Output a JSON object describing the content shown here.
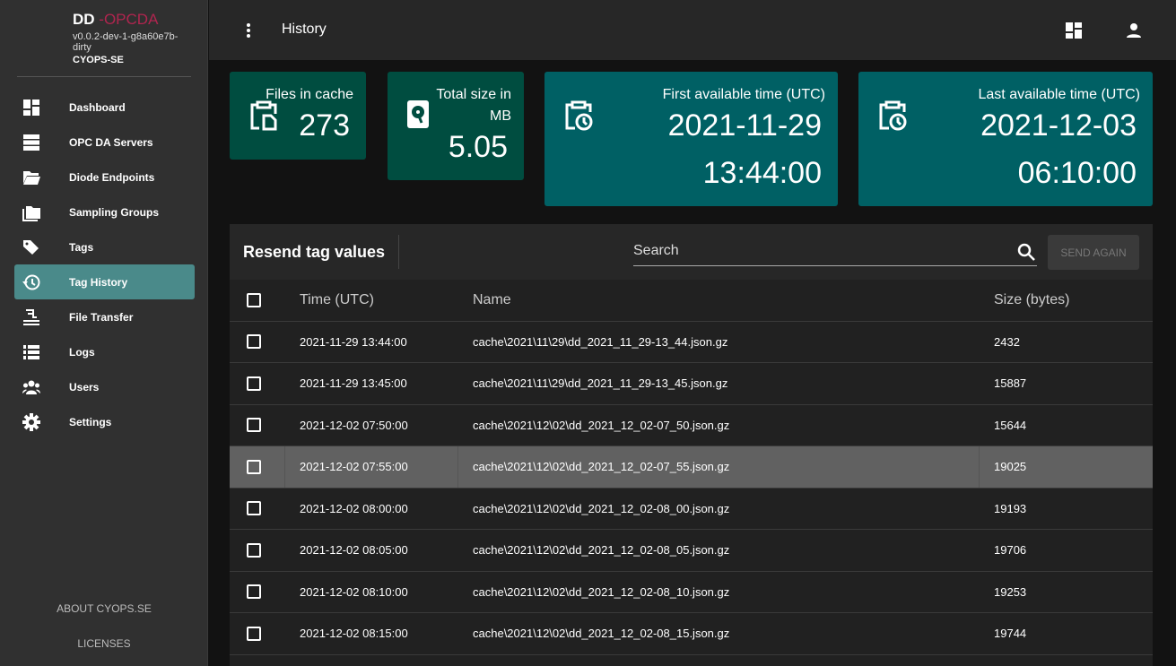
{
  "sidebar": {
    "brand": "DD",
    "brand_suffix": " -OPCDA",
    "version": "v0.0.2-dev-1-g8a60e7b-dirty",
    "org": "CYOPS-SE",
    "items": [
      {
        "label": "Dashboard",
        "icon": "dashboard-icon"
      },
      {
        "label": "OPC DA Servers",
        "icon": "server-icon"
      },
      {
        "label": "Diode Endpoints",
        "icon": "folder-open-icon"
      },
      {
        "label": "Sampling Groups",
        "icon": "folders-icon"
      },
      {
        "label": "Tags",
        "icon": "tags-icon"
      },
      {
        "label": "Tag History",
        "icon": "history-icon",
        "active": true
      },
      {
        "label": "File Transfer",
        "icon": "file-transfer-icon"
      },
      {
        "label": "Logs",
        "icon": "list-icon"
      },
      {
        "label": "Users",
        "icon": "users-icon"
      },
      {
        "label": "Settings",
        "icon": "gear-icon"
      }
    ],
    "about": "ABOUT CYOPS.SE",
    "licenses": "LICENSES"
  },
  "topbar": {
    "title": "History"
  },
  "cards": [
    {
      "label": "Files in cache",
      "value": "273"
    },
    {
      "label": "Total size in MB",
      "value": "5.05"
    },
    {
      "label": "First available time (UTC)",
      "value_date": "2021-11-29",
      "value_time": "13:44:00"
    },
    {
      "label": "Last available time (UTC)",
      "value_date": "2021-12-03",
      "value_time": "06:10:00"
    }
  ],
  "colors": {
    "card_green": "#004d40",
    "card_teal": "#006064",
    "active_nav": "#4a8a8a",
    "brand_accent": "#b0254f"
  },
  "panel": {
    "title": "Resend tag values",
    "search_placeholder": "Search",
    "send_label": "SEND AGAIN",
    "columns": [
      "Time (UTC)",
      "Name",
      "Size (bytes)"
    ],
    "rows": [
      {
        "time": "2021-11-29 13:44:00",
        "name": "cache\\2021\\11\\29\\dd_2021_11_29-13_44.json.gz",
        "size": "2432"
      },
      {
        "time": "2021-11-29 13:45:00",
        "name": "cache\\2021\\11\\29\\dd_2021_11_29-13_45.json.gz",
        "size": "15887"
      },
      {
        "time": "2021-12-02 07:50:00",
        "name": "cache\\2021\\12\\02\\dd_2021_12_02-07_50.json.gz",
        "size": "15644"
      },
      {
        "time": "2021-12-02 07:55:00",
        "name": "cache\\2021\\12\\02\\dd_2021_12_02-07_55.json.gz",
        "size": "19025",
        "hover": true
      },
      {
        "time": "2021-12-02 08:00:00",
        "name": "cache\\2021\\12\\02\\dd_2021_12_02-08_00.json.gz",
        "size": "19193"
      },
      {
        "time": "2021-12-02 08:05:00",
        "name": "cache\\2021\\12\\02\\dd_2021_12_02-08_05.json.gz",
        "size": "19706"
      },
      {
        "time": "2021-12-02 08:10:00",
        "name": "cache\\2021\\12\\02\\dd_2021_12_02-08_10.json.gz",
        "size": "19253"
      },
      {
        "time": "2021-12-02 08:15:00",
        "name": "cache\\2021\\12\\02\\dd_2021_12_02-08_15.json.gz",
        "size": "19744"
      }
    ]
  }
}
